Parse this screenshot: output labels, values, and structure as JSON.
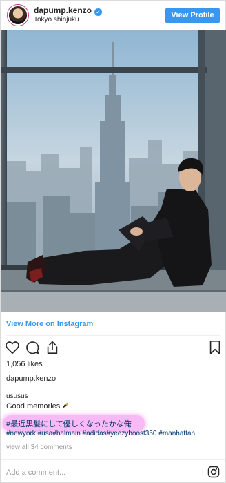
{
  "header": {
    "username": "dapump.kenzo",
    "location": "Tokyo shinjuku",
    "view_profile_label": "View Profile"
  },
  "post": {
    "view_more_label": "View More on Instagram",
    "likes": "1,056 likes",
    "owner": "dapump.kenzo",
    "caption_username": "ususus",
    "caption_line1": "Good memories",
    "caption_line2": "#最近黒髪にして優しくなったかな俺",
    "hashtags": "#newyork #usa#balmain #adidas#yeezyboost350 #manhattan",
    "view_comments": "view all 34 comments",
    "add_comment_placeholder": "Add a comment..."
  },
  "colors": {
    "accent": "#3897f0",
    "hashtag": "#003569",
    "highlight": "#f08aeb"
  },
  "icons": [
    "verified-badge-icon",
    "heart-icon",
    "comment-icon",
    "share-icon",
    "bookmark-icon",
    "music-note-icon",
    "instagram-logo-icon"
  ]
}
